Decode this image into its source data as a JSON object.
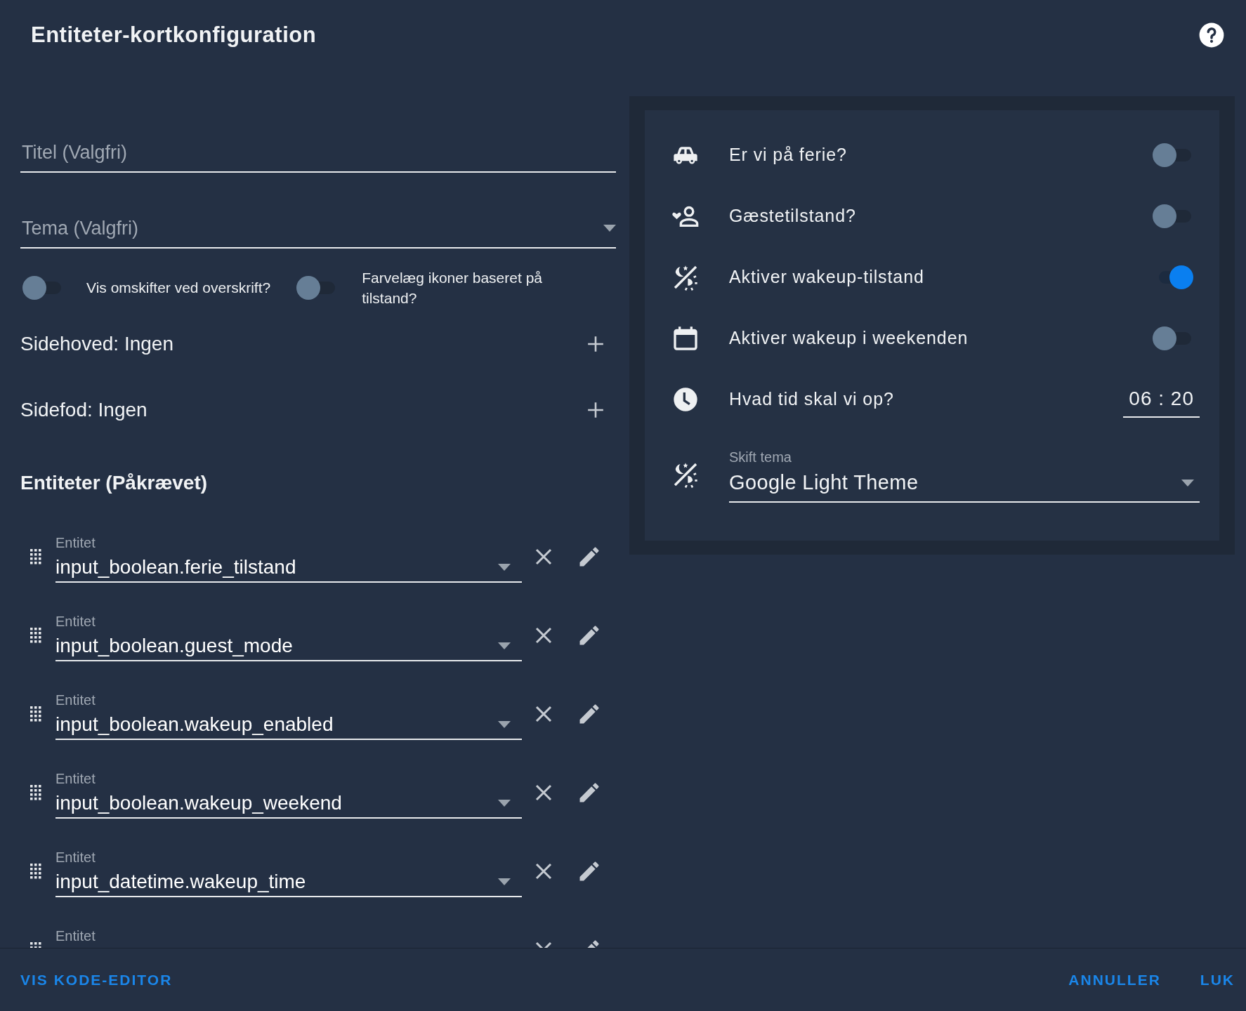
{
  "dialog": {
    "title": "Entiteter-kortkonfiguration"
  },
  "title_field": {
    "placeholder": "Titel (Valgfri)"
  },
  "theme_field": {
    "placeholder": "Tema (Valgfri)"
  },
  "options": [
    {
      "label": "Vis omskifter ved overskrift?",
      "on": false
    },
    {
      "label": "Farvelæg ikoner baseret på tilstand?",
      "on": false
    }
  ],
  "header_row": {
    "label": "Sidehoved: Ingen"
  },
  "footer_row": {
    "label": "Sidefod: Ingen"
  },
  "entities": {
    "heading": "Entiteter (Påkrævet)",
    "rows": [
      {
        "label": "Entitet",
        "value": "input_boolean.ferie_tilstand"
      },
      {
        "label": "Entitet",
        "value": "input_boolean.guest_mode"
      },
      {
        "label": "Entitet",
        "value": "input_boolean.wakeup_enabled"
      },
      {
        "label": "Entitet",
        "value": "input_boolean.wakeup_weekend"
      },
      {
        "label": "Entitet",
        "value": "input_datetime.wakeup_time"
      },
      {
        "label": "Entitet"
      }
    ]
  },
  "preview": {
    "rows": [
      {
        "kind": "toggle",
        "label": "Er vi på ferie?",
        "on": false
      },
      {
        "kind": "toggle",
        "label": "Gæstetilstand?",
        "on": false
      },
      {
        "kind": "toggle",
        "label": "Aktiver wakeup-tilstand",
        "on": true
      },
      {
        "kind": "toggle",
        "label": "Aktiver wakeup i weekenden",
        "on": false
      },
      {
        "kind": "time",
        "label": "Hvad tid skal vi op?",
        "value": "06 : 20"
      },
      {
        "kind": "select",
        "label": "Skift tema",
        "value": "Google Light Theme"
      }
    ]
  },
  "footer": {
    "left_button": "VIS KODE-EDITOR",
    "right_buttons": [
      "ANNULLER",
      "LUK"
    ]
  }
}
